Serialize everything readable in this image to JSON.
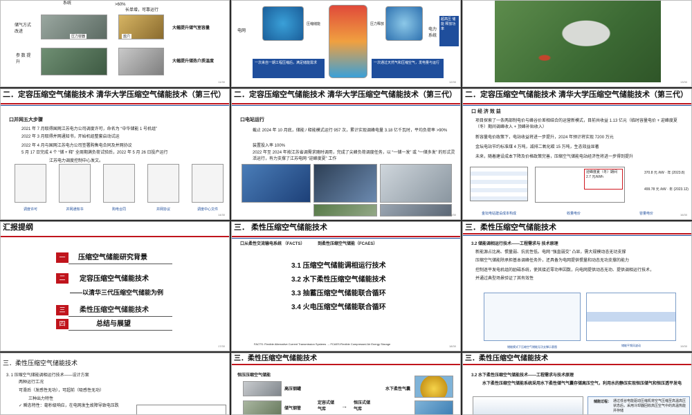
{
  "slides": {
    "s1": {
      "header_text": "系统",
      "pct": ">60%",
      "top_right_1": "长单增，可靠运行",
      "label_storage": "储气方式改进",
      "label_param": "参 数 提升",
      "cap_pressure": "压力容器",
      "cap_cave": "盐穴",
      "highlight_1": "大幅提升储气室容量",
      "highlight_2": "大幅提升储热介质温度",
      "page": "11/30"
    },
    "s2": {
      "label_left": "电网",
      "label_right": "电力系统",
      "cap_comp": "压缩储能",
      "cap_exp": "压力释放",
      "bottom_left": "一次来自一期工程压缩后，满足储能需求",
      "bottom_right": "一次通过天然气和压缩空气，发电量与运行",
      "side_text": "超高压 储能 释放功率",
      "page": "12/30"
    },
    "s3": {
      "page": "13/30"
    },
    "s4": {
      "title": "二．定容压缩空气储能技术   清华大学压缩空气储能技术（第三代）",
      "sub": "口并网五大步骤",
      "lines": [
        "2021 年 7 月取得国网江苏电力公司调度许可，命名为 “中华储能 1 号机组”",
        "2022 年 3 月取得并网通知书，开始机组整套启动试运",
        "2022 年 4 月与国网江苏电力公司签署购售电合同及并网协议",
        "5 月 17 日完成 4 个 “储 + 释” 全周期满负荷试验后，2022 年 5 月 26 日投产运行",
        "江苏电力调度控制中心发文。"
      ],
      "captions": [
        "调度许可",
        "并网通知书",
        "购电合同",
        "并网协议",
        "调度中心文件"
      ],
      "page": "14/30"
    },
    "s5": {
      "title": "二．定容压缩空气储能技术   清华大学压缩空气储能技术（第三代）",
      "sub": "口电站运行",
      "lines": [
        "截止 2024 年 10 月底，储能 / 释能模式运行 957 次，累计实现调峰电量 3.18 亿千瓦时，平均负荷率 >90%",
        "装置投入率 100%",
        "2022 年至 2024 年按江苏省调需求随时调用，完成了尖峰负荷调度任务，以 “一储一发” 或 “一储多发” 的形式灵活运行，有力支撑了江苏电网 “迎峰度夏” 工作"
      ],
      "page": "15/30"
    },
    "s6": {
      "title": "二．定容压缩空气储能技术   清华大学压缩空气储能技术（第三代）",
      "sub": "口 经 济 效 益",
      "lines": [
        "项目探索了一条两部制电价与峰谷价差相结合的运营新模式，目前共收益 1.13 亿元（临时容量电价 + 迎峰度夏（冬）期间调峰收入 + 顶峰补贴收入）",
        "新容量电价政策下，电站收益将进一步提升，2024 年预计将实现 7200 万元",
        "金坛电站节约标准煤 4 万吨，减排二氧化碳 15 万吨，生态效益显著",
        "未来，随着建设成本下降及价格政策完善，压缩空气储能电站经济性将进一步得到提升"
      ],
      "cap_1": "金坛电站建设成本构成",
      "cap_2": "收量电价",
      "cap_3": "容量电价",
      "box_red_1": "迎峰度夏（冬）期间",
      "box_red_2": "2.7 元/kWh",
      "val_1": "370.8 元 /kW · 年 (2023.8)",
      "val_2": "499.78 元 /kW · 年 (2023.12)",
      "page": "16/30"
    },
    "s7": {
      "title": "汇报提纲",
      "items": [
        {
          "num": "一",
          "label": "压缩空气储能研究背景"
        },
        {
          "num": "二",
          "label": "定容压缩空气储能技术"
        },
        {
          "num": "",
          "label": "——以清华三代压缩空气储能为例"
        },
        {
          "num": "三",
          "label": "柔性压缩空气储能技术"
        },
        {
          "num": "四",
          "label": "总结与展望"
        }
      ],
      "page": "17/30"
    },
    "s8": {
      "title": "三．   柔性压缩空气储能技术",
      "sub_left": "口从柔性交流输电系统 （FACTS）",
      "sub_right": "到柔性压缩空气储能（FCAES）",
      "items": [
        "3.1 压缩空气储能调相运行技术",
        "3.2 水下柔性压缩空气储能技术",
        "3.3 抽蓄压缩空气储能联合循环",
        "3.4 火电压缩空气储能联合循环"
      ],
      "footer": "FACTS: Flexible Alternative Current Transmission Systems → FCAES:Flexible Compressed Air Energy Storage",
      "page": "18/30"
    },
    "s9": {
      "title": "三．柔性压缩空气储能技术",
      "sub": "3.2 储能调相运行技术——工程需求与   技术原理",
      "lines": [
        "新能源占比高、惯量弱、抗扰性低。电网 “强直弱交” 凸显，需大规模动态无功支撑",
        "压缩空气储能除承担基本调峰任务外，还具备为电网提供惯量和动态无功支撑的能力",
        "控制逐平发电机组的励磁系统，使其接近零功率因数，向电网提供动态无功、提供调相运行技术，",
        "并通过典型场景验证了其有效性"
      ],
      "cap_1": "储能模式下压缩空气储能无功支撑示意图",
      "cap_2": "储能平频风波动",
      "page": "19/30"
    },
    "s10": {
      "title": "三．柔性压缩空气储能技术",
      "sub": "3.   1 压缩空气储能调相运行技术——设计方案",
      "lines": [
        "两种运行工况",
        "可滑后（发感性无功），可超前（吸感性无功）",
        "三种出力特性",
        "✓ 瞬态特性：毫秒级响应，在电网发生故障导致电压跌"
      ]
    },
    "s11": {
      "title": "三．柔性压缩空气储能技术",
      "sub": "恒压压缩空气储能",
      "lbl_1": "高压钢罐",
      "lbl_2": "储气钢管",
      "lbl_3": "定容式储气库",
      "lbl_4": "恒压式储气库",
      "lbl_5": "水下柔性气囊"
    },
    "s12": {
      "title": "三．柔性压缩空气储能技术",
      "sub": "3.2 水下柔性压缩空气储能技术——工程需求与技术原理",
      "line_1": "水下柔性压缩空气储能系统采用水下柔性储气气囊存储高压空气，利用水的静压实现恒压储气和恒压透平发电",
      "box_label": "储能过程：",
      "box_text": "通过低谷电能驱动压缩机将空气压缩至高温高压状态后，采用冷却器回收高压空气中的高温热能并存储"
    }
  },
  "colors": {
    "red": "#c0141c",
    "blue": "#1f4e9c",
    "orange": "#e07a00"
  }
}
